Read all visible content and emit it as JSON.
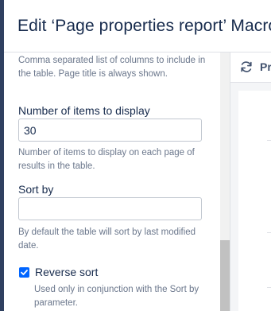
{
  "dialog": {
    "title": "Edit ‘Page properties report’ Macro"
  },
  "form": {
    "columns_help": "Comma separated list of columns to include in the table. Page title is always shown.",
    "items": {
      "label": "Number of items to display",
      "value": "30",
      "help": "Number of items to display on each page of results in the table."
    },
    "sort": {
      "label": "Sort by",
      "value": "",
      "help": "By default the table will sort by last modified date."
    },
    "reverse": {
      "label": "Reverse sort",
      "checked": true,
      "help": "Used only in conjunction with the Sort by parameter."
    }
  },
  "preview": {
    "label": "Pr",
    "icon": "refresh-icon"
  },
  "colors": {
    "accent": "#0065ff",
    "text": "#172b4d",
    "subtle_text": "#6b778c"
  }
}
